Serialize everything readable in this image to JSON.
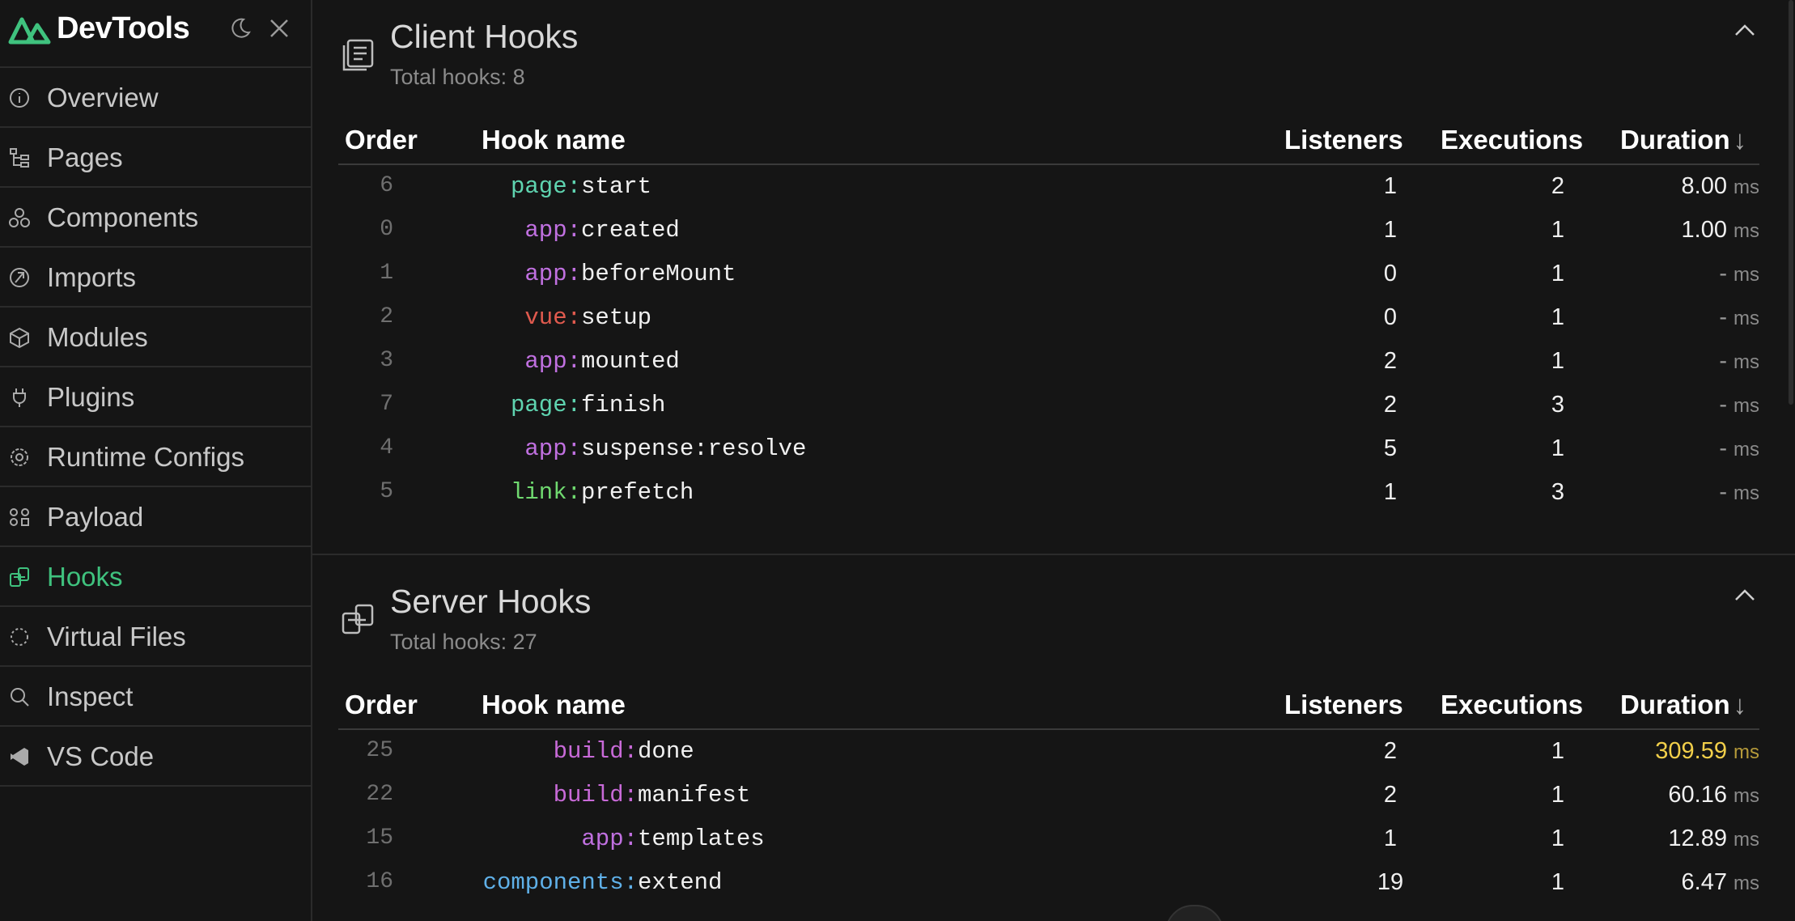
{
  "app": {
    "title": "DevTools",
    "brand_color": "#3fc27e"
  },
  "sidebar": {
    "items": [
      {
        "label": "Overview",
        "icon": "info-icon",
        "active": false
      },
      {
        "label": "Pages",
        "icon": "tree-icon",
        "active": false
      },
      {
        "label": "Components",
        "icon": "components-icon",
        "active": false
      },
      {
        "label": "Imports",
        "icon": "imports-icon",
        "active": false
      },
      {
        "label": "Modules",
        "icon": "cube-icon",
        "active": false
      },
      {
        "label": "Plugins",
        "icon": "plug-icon",
        "active": false
      },
      {
        "label": "Runtime Configs",
        "icon": "gear-icon",
        "active": false
      },
      {
        "label": "Payload",
        "icon": "payload-icon",
        "active": false
      },
      {
        "label": "Hooks",
        "icon": "hooks-icon",
        "active": true
      },
      {
        "label": "Virtual Files",
        "icon": "dashed-circle-icon",
        "active": false
      },
      {
        "label": "Inspect",
        "icon": "search-icon",
        "active": false
      },
      {
        "label": "VS Code",
        "icon": "vscode-icon",
        "active": false
      }
    ]
  },
  "columns": {
    "order": "Order",
    "hook_name": "Hook name",
    "listeners": "Listeners",
    "executions": "Executions",
    "duration": "Duration",
    "sort_arrow": "↓",
    "ms": "ms"
  },
  "client_hooks": {
    "title": "Client Hooks",
    "subtitle": "Total hooks: 8",
    "rows": [
      {
        "order": "6",
        "prefix": "page:",
        "name": "start",
        "listeners": "1",
        "executions": "2",
        "duration": "8.00"
      },
      {
        "order": "0",
        "prefix": "app:",
        "name": "created",
        "listeners": "1",
        "executions": "1",
        "duration": "1.00"
      },
      {
        "order": "1",
        "prefix": "app:",
        "name": "beforeMount",
        "listeners": "0",
        "executions": "1",
        "duration": "-"
      },
      {
        "order": "2",
        "prefix": "vue:",
        "name": "setup",
        "listeners": "0",
        "executions": "1",
        "duration": "-"
      },
      {
        "order": "3",
        "prefix": "app:",
        "name": "mounted",
        "listeners": "2",
        "executions": "1",
        "duration": "-"
      },
      {
        "order": "7",
        "prefix": "page:",
        "name": "finish",
        "listeners": "2",
        "executions": "3",
        "duration": "-"
      },
      {
        "order": "4",
        "prefix": "app:",
        "name": "suspense:resolve",
        "listeners": "5",
        "executions": "1",
        "duration": "-"
      },
      {
        "order": "5",
        "prefix": "link:",
        "name": "prefetch",
        "listeners": "1",
        "executions": "3",
        "duration": "-"
      }
    ]
  },
  "server_hooks": {
    "title": "Server Hooks",
    "subtitle": "Total hooks: 27",
    "rows": [
      {
        "order": "25",
        "prefix": "build:",
        "name": "done",
        "listeners": "2",
        "executions": "1",
        "duration": "309.59"
      },
      {
        "order": "22",
        "prefix": "build:",
        "name": "manifest",
        "listeners": "2",
        "executions": "1",
        "duration": "60.16"
      },
      {
        "order": "15",
        "prefix": "app:",
        "name": "templates",
        "listeners": "1",
        "executions": "1",
        "duration": "12.89"
      },
      {
        "order": "16",
        "prefix": "components:",
        "name": "extend",
        "listeners": "19",
        "executions": "1",
        "duration": "6.47"
      }
    ]
  },
  "colors": {
    "page": "#5fd4b0",
    "app": "#c070e0",
    "vue": "#e05a4e",
    "link": "#6fd86f",
    "build": "#c86ad8",
    "components": "#5fb0e8",
    "slow": "#f2cf4a"
  }
}
